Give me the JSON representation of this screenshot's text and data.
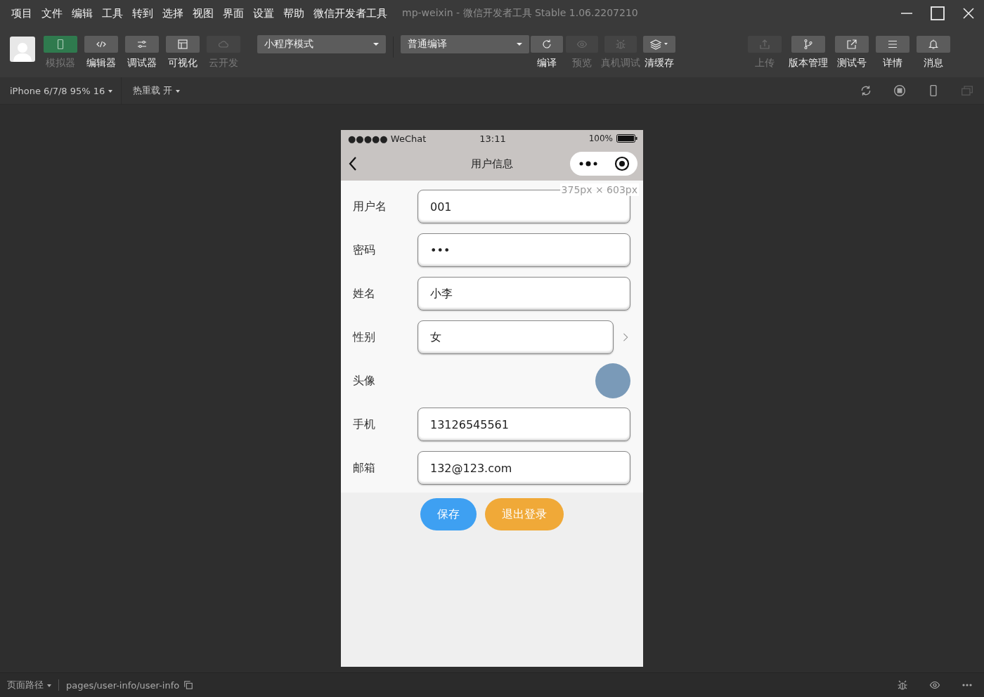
{
  "menu": [
    "项目",
    "文件",
    "编辑",
    "工具",
    "转到",
    "选择",
    "视图",
    "界面",
    "设置",
    "帮助",
    "微信开发者工具"
  ],
  "window_title": "mp-weixin - 微信开发者工具 Stable 1.06.2207210",
  "toolbar": {
    "left_buttons": [
      {
        "label": "模拟器",
        "selected": true,
        "disabled": false
      },
      {
        "label": "编辑器",
        "selected": false,
        "disabled": false
      },
      {
        "label": "调试器",
        "selected": false,
        "disabled": false
      },
      {
        "label": "可视化",
        "selected": false,
        "disabled": false
      },
      {
        "label": "云开发",
        "selected": false,
        "disabled": true
      }
    ],
    "mode_select": "小程序模式",
    "compile_select": "普通编译",
    "compile_buttons": [
      {
        "label": "编译",
        "disabled": false
      },
      {
        "label": "预览",
        "disabled": true
      },
      {
        "label": "真机调试",
        "disabled": true
      },
      {
        "label": "清缓存",
        "disabled": false
      }
    ],
    "right_buttons": [
      {
        "label": "上传",
        "disabled": true
      },
      {
        "label": "版本管理",
        "disabled": false
      },
      {
        "label": "测试号",
        "disabled": false
      },
      {
        "label": "详情",
        "disabled": false
      },
      {
        "label": "消息",
        "disabled": false
      }
    ]
  },
  "device_bar": {
    "device": "iPhone 6/7/8 95% 16",
    "hot_reload": "热重载 开"
  },
  "phone": {
    "carrier": "●●●●● WeChat",
    "time": "13:11",
    "battery": "100%",
    "nav_title": "用户信息",
    "size_tip": "375px × 603px",
    "form": [
      {
        "label": "用户名",
        "kind": "input",
        "value": "001"
      },
      {
        "label": "密码",
        "kind": "input",
        "value": "•••"
      },
      {
        "label": "姓名",
        "kind": "input",
        "value": "小李"
      },
      {
        "label": "性别",
        "kind": "picker",
        "value": "女"
      },
      {
        "label": "头像",
        "kind": "avatar"
      },
      {
        "label": "手机",
        "kind": "input",
        "value": "13126545561"
      },
      {
        "label": "邮箱",
        "kind": "input",
        "value": "132@123.com"
      }
    ],
    "buttons": [
      {
        "label": "保存",
        "color": "#3ea0f2"
      },
      {
        "label": "退出登录",
        "color": "#f0a938"
      }
    ]
  },
  "status_bar": {
    "page_path_label": "页面路径",
    "path": "pages/user-info/user-info"
  }
}
